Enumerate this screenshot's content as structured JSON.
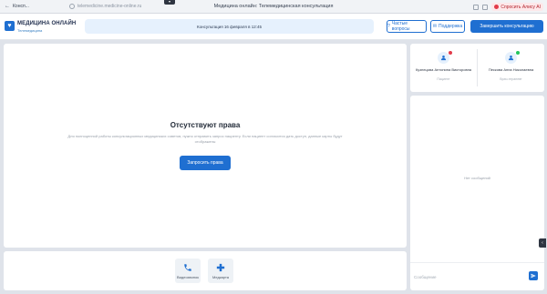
{
  "browser": {
    "tab_title": "Консп...",
    "url": "telemedicine.medicine-online.ru",
    "page_title": "Медицина онлайн: Телемедицинская консультация",
    "ask_label": "Спросить Алису AI"
  },
  "header": {
    "brand_title": "МЕДИЦИНА ОНЛАЙН",
    "brand_sub": "Телемедицина",
    "consultation_info": "Консультация 16 февраля в 12:45",
    "faq_label": "Частые вопросы",
    "support_label": "Поддержка",
    "finish_label": "Завершить консультацию"
  },
  "no_permissions": {
    "title": "Отсутствуют права",
    "description": "Для полноценной работы консультационных медицинских советов, нужно отправить запрос пациенту. Если пациент согласится дать доступ, данные карты будут отображены",
    "request_button": "Запросить права"
  },
  "controls": [
    {
      "label": "Видеозвонок",
      "icon": "phone-icon"
    },
    {
      "label": "Медкарта",
      "icon": "medical-cross-icon"
    }
  ],
  "participants": [
    {
      "name": "Кузнецова Антонина Викторовна",
      "role": "Пациент",
      "status_color": "#e23b4a"
    },
    {
      "name": "Пескова Анна Николаевна",
      "role": "Врач-терапевт",
      "status_color": "#22c55e"
    }
  ],
  "chat": {
    "empty_text": "Нет сообщений",
    "input_placeholder": "Сообщение"
  },
  "colors": {
    "accent": "#1f6fd1",
    "offline": "#e23b4a",
    "online": "#22c55e"
  }
}
